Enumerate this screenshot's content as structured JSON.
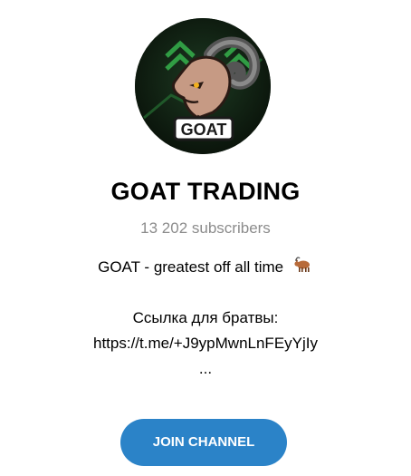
{
  "channel": {
    "avatar_text": "GOAT",
    "title": "GOAT TRADING",
    "subscribers": "13 202 subscribers",
    "description": {
      "line1": "GOAT - greatest off all time",
      "line1_emoji": "goat-emoji",
      "line2": "Ссылка для братвы:",
      "line3": "https://t.me/+J9ypMwnLnFEyYjIy",
      "more": "..."
    }
  },
  "actions": {
    "join_label": "JOIN CHANNEL"
  },
  "colors": {
    "accent": "#2b83c8",
    "subtitle": "#8c8c8c",
    "avatar_bg": "#0f1d12",
    "avatar_arrows": "#37b24d"
  }
}
